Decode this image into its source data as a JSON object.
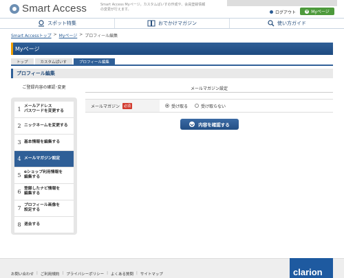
{
  "header": {
    "logo_text": "Smart Access",
    "description": "Smart Access Myページ。カスタムぱいすの作成や、会員登録情報の変更が行えます。",
    "logout_label": "ログアウト",
    "mypage_label": "Myページ"
  },
  "gnav": {
    "items": [
      {
        "label": "スポット特集",
        "icon": "map-pin-icon"
      },
      {
        "label": "おでかけマガジン",
        "icon": "book-icon"
      },
      {
        "label": "使い方ガイド",
        "icon": "magnifier-icon"
      }
    ]
  },
  "breadcrumb": {
    "items": [
      "Smart Accessトップ",
      "Myページ",
      "プロフィール編集"
    ]
  },
  "page_title": "Myページ",
  "tabs": [
    {
      "label": "トップ",
      "active": false
    },
    {
      "label": "カスタムぱいす",
      "active": false
    },
    {
      "label": "プロフィール編集",
      "active": true
    }
  ],
  "section_title": "プロフィール編集",
  "sidebar": {
    "heading": "ご登録内容の確認･変更",
    "items": [
      {
        "num": "1",
        "label": "メールアドレス\nパスワードを変更する"
      },
      {
        "num": "2",
        "label": "ニックネームを変更する"
      },
      {
        "num": "3",
        "label": "基本情報を編集する"
      },
      {
        "num": "4",
        "label": "メールマガジン設定"
      },
      {
        "num": "5",
        "label": "eショップ利用情報を\n編集する"
      },
      {
        "num": "6",
        "label": "登録したナビ情報を\n編集する"
      },
      {
        "num": "7",
        "label": "プロフィール画像を\n設定する"
      },
      {
        "num": "8",
        "label": "退会する"
      }
    ],
    "current_index": 3
  },
  "form": {
    "header": "メールマガジン設定",
    "label": "メールマガジン",
    "required_badge": "必須",
    "options": [
      "受け取る",
      "受け取らない"
    ],
    "selected": "受け取る"
  },
  "confirm_button_label": "内容を確認する",
  "footer": {
    "links": [
      "お問い合わせ",
      "ご利用規約",
      "プライバシーポリシー",
      "よくある質問",
      "サイトマップ"
    ],
    "brand": "clarion"
  },
  "colors": {
    "primary": "#2f5f97",
    "accent": "#f1a000",
    "mypage_green": "#4d9a3c",
    "required_red": "#d23b2f"
  }
}
